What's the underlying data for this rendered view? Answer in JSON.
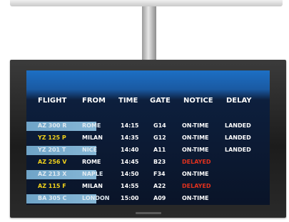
{
  "board": {
    "headers": {
      "flight": "FLIGHT",
      "from": "FROM",
      "time": "TIME",
      "gate": "GATE",
      "notice": "NOTICE",
      "delay": "DELAY"
    },
    "rows": [
      {
        "flight": "AZ 300 R",
        "from": "ROME",
        "time": "14:15",
        "gate": "G14",
        "notice": "ON-TIME",
        "delay": "LANDED",
        "style": "hl"
      },
      {
        "flight": "YZ 125 P",
        "from": "MILAN",
        "time": "14:35",
        "gate": "G12",
        "notice": "ON-TIME",
        "delay": "LANDED",
        "style": "plain"
      },
      {
        "flight": "YZ 201 T",
        "from": "NICE",
        "time": "14:40",
        "gate": "A11",
        "notice": "ON-TIME",
        "delay": "LANDED",
        "style": "hl"
      },
      {
        "flight": "AZ 256 V",
        "from": "ROME",
        "time": "14:45",
        "gate": "B23",
        "notice": "DELAYED",
        "delay": "",
        "style": "plain"
      },
      {
        "flight": "AZ 213 X",
        "from": "NAPLE",
        "time": "14:50",
        "gate": "F34",
        "notice": "ON-TIME",
        "delay": "",
        "style": "hl"
      },
      {
        "flight": "AZ 115 F",
        "from": "MILAN",
        "time": "14:55",
        "gate": "A22",
        "notice": "DELAYED",
        "delay": "",
        "style": "plain"
      },
      {
        "flight": "BA 305 C",
        "from": "LONDON",
        "time": "15:00",
        "gate": "A09",
        "notice": "ON-TIME",
        "delay": "",
        "style": "hl"
      }
    ],
    "colors": {
      "flight_text": "#f2d21b",
      "delayed_text": "#e0311e",
      "text": "#ffffff",
      "screen_top": "#1d6fc4",
      "screen_bg": "#0a1428"
    }
  }
}
